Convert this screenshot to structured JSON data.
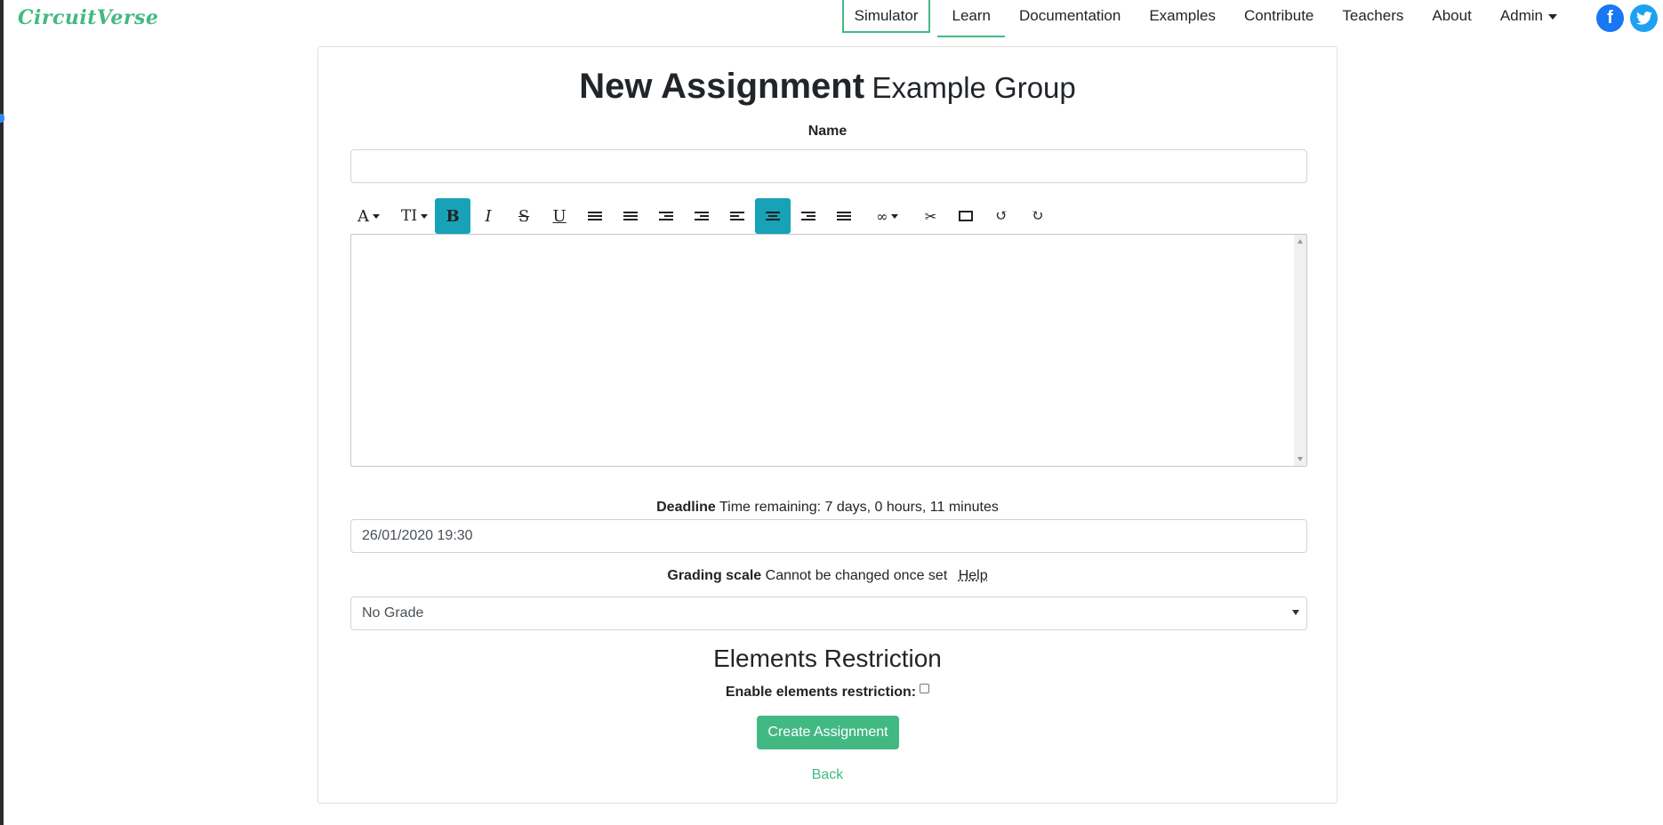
{
  "brand": {
    "logo": "CircuitVerse",
    "accent": "#42b983"
  },
  "nav": {
    "items": [
      "Simulator",
      "Learn",
      "Documentation",
      "Examples",
      "Contribute",
      "Teachers",
      "About",
      "Admin"
    ],
    "social": [
      "facebook-icon",
      "twitter-icon"
    ]
  },
  "page": {
    "title": "New Assignment",
    "subtitle": "Example Group"
  },
  "form": {
    "name_label": "Name",
    "name_value": "",
    "toolbar": {
      "icons": [
        "font-color",
        "font-size",
        "bold",
        "italic",
        "strikethrough",
        "underline",
        "unordered-list",
        "ordered-list",
        "outdent",
        "indent",
        "align-left",
        "align-center",
        "align-right",
        "justify",
        "link",
        "unlink",
        "image",
        "undo",
        "redo"
      ],
      "active": [
        "bold",
        "align-center"
      ]
    },
    "deadline_label": "Deadline",
    "deadline_note": "Time remaining: 7 days, 0 hours, 11 minutes",
    "deadline_value": "26/01/2020 19:30",
    "grading_label": "Grading scale",
    "grading_note": "Cannot be changed once set",
    "grading_help": "Help",
    "grading_value": "No Grade",
    "restriction_heading": "Elements Restriction",
    "restriction_label": "Enable elements restriction:",
    "restriction_checked": false,
    "submit_label": "Create Assignment",
    "back_label": "Back"
  }
}
